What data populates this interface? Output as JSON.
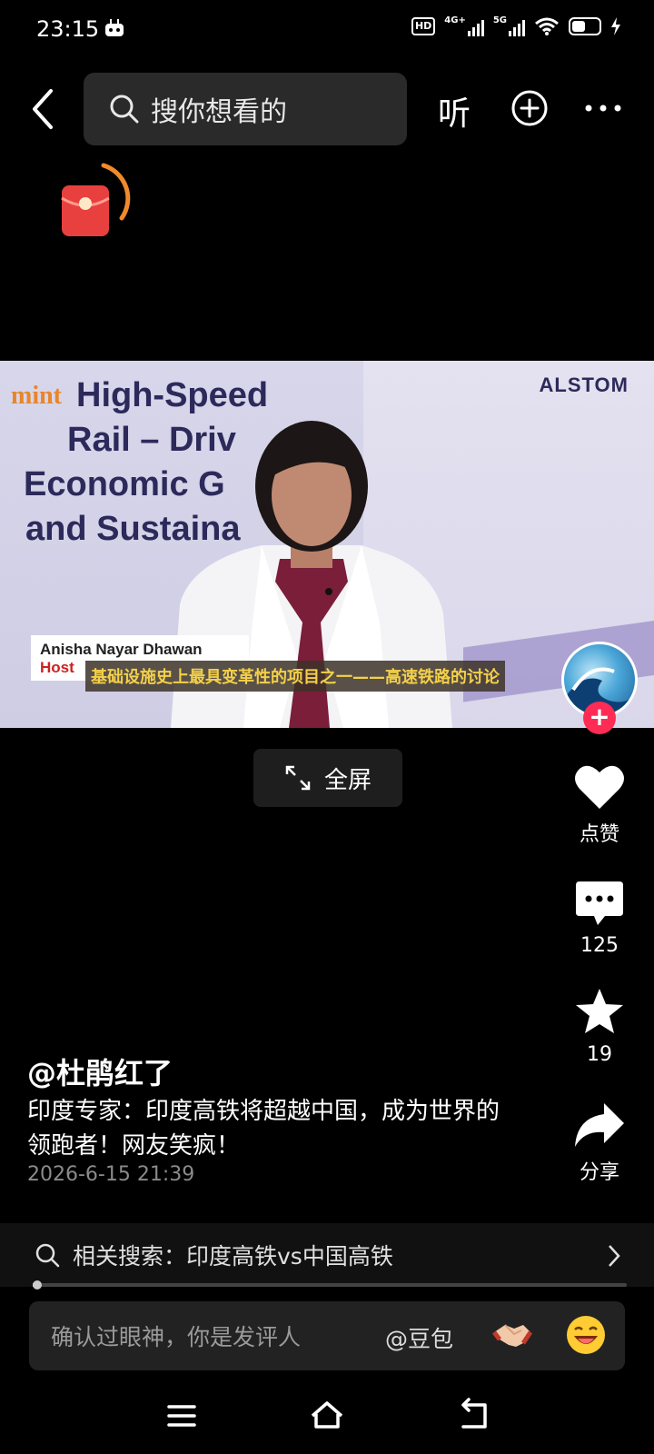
{
  "status_bar": {
    "time": "23:15",
    "hd_label": "HD",
    "network1": "4G+",
    "network2": "5G"
  },
  "top_nav": {
    "search_placeholder": "搜你想看的",
    "listen_label": "听"
  },
  "video": {
    "brand": "mint",
    "title_lines": [
      "High-Speed",
      "Rail – Driv",
      "Economic G",
      "and Sustaina"
    ],
    "sponsor": "ALSTOM",
    "presenter_name": "Anisha Nayar Dhawan",
    "presenter_role": "Host",
    "subtitle": "基础设施史上最具变革性的项目之一——高速铁路的讨论",
    "fullscreen_label": "全屏"
  },
  "actions": {
    "like_label": "点赞",
    "comment_count": "125",
    "favorite_count": "19",
    "share_label": "分享"
  },
  "post": {
    "author": "@杜鹃红了",
    "description": "印度专家：印度高铁将超越中国，成为世界的领跑者！网友笑疯！",
    "date": "2026-6-15 21:39"
  },
  "related_search": {
    "text": "相关搜索：印度高铁vs中国高铁"
  },
  "comment_bar": {
    "placeholder": "确认过眼神，你是发评人",
    "mention": "@豆包"
  },
  "colors": {
    "accent_red": "#fe2c55",
    "subtitle_yellow": "#f3d04a",
    "background": "#000000"
  }
}
